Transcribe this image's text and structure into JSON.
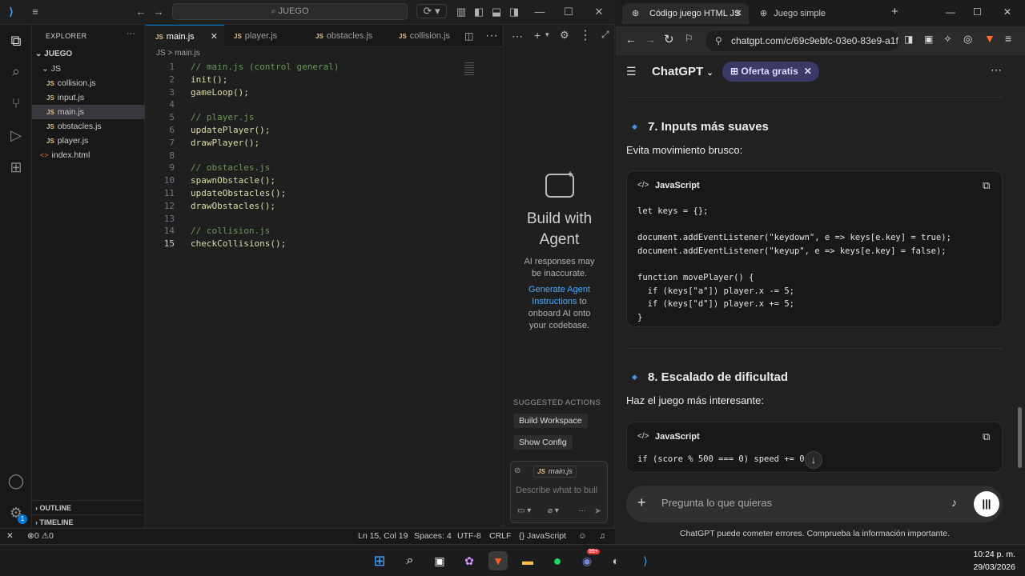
{
  "vscode": {
    "search": "JUEGO",
    "explorer_title": "EXPLORER",
    "tree": [
      {
        "label": "JUEGO",
        "type": "folder"
      },
      {
        "label": "JS",
        "type": "folder"
      },
      {
        "label": "collision.js",
        "type": "js"
      },
      {
        "label": "input.js",
        "type": "js"
      },
      {
        "label": "main.js",
        "type": "js",
        "selected": true
      },
      {
        "label": "obstacles.js",
        "type": "js"
      },
      {
        "label": "player.js",
        "type": "js"
      },
      {
        "label": "index.html",
        "type": "html"
      }
    ],
    "outline": "OUTLINE",
    "timeline": "TIMELINE",
    "tabs": [
      "main.js",
      "player.js",
      "obstacles.js",
      "collision.js"
    ],
    "breadcrumb": "JS  >  main.js",
    "lines": [
      {
        "n": "1",
        "t": "// main.js (control general)",
        "c": true
      },
      {
        "n": "2",
        "t": "init();"
      },
      {
        "n": "3",
        "t": "gameLoop();"
      },
      {
        "n": "4",
        "t": ""
      },
      {
        "n": "5",
        "t": "// player.js",
        "c": true
      },
      {
        "n": "6",
        "t": "updatePlayer();"
      },
      {
        "n": "7",
        "t": "drawPlayer();"
      },
      {
        "n": "8",
        "t": ""
      },
      {
        "n": "9",
        "t": "// obstacles.js",
        "c": true
      },
      {
        "n": "10",
        "t": "spawnObstacle();"
      },
      {
        "n": "11",
        "t": "updateObstacles();"
      },
      {
        "n": "12",
        "t": "drawObstacles();"
      },
      {
        "n": "13",
        "t": ""
      },
      {
        "n": "14",
        "t": "// collision.js",
        "c": true
      },
      {
        "n": "15",
        "t": "checkCollisions();"
      }
    ],
    "agent": {
      "title1": "Build with",
      "title2": "Agent",
      "note1": "AI responses may",
      "note2": "be inaccurate.",
      "link1": "Generate Agent",
      "link2": "Instructions",
      "rest1": " to",
      "rest2": "onboard AI onto",
      "rest3": "your codebase.",
      "suggested": "SUGGESTED ACTIONS",
      "btn1": "Build Workspace",
      "btn2": "Show Config",
      "ctx_file": "main.js",
      "placeholder": "Describe what to buil"
    },
    "status": {
      "errors": "0",
      "warnings": "0",
      "pos": "Ln 15, Col 19",
      "spaces": "Spaces: 4",
      "enc": "UTF-8",
      "eol": "CRLF",
      "lang": "JavaScript",
      "accounts_badge": "1"
    }
  },
  "browser": {
    "tab1": "Código juego HTML JS",
    "tab2": "Juego simple",
    "url": "chatgpt.com/c/69c9ebfc-03e0-83e9-a1f",
    "app": "ChatGPT",
    "offer": "Oferta gratis",
    "s7_title": "7. Inputs más suaves",
    "s7_desc": "Evita movimiento brusco:",
    "lang": "JavaScript",
    "code7": [
      "let keys = {};",
      "",
      "document.addEventListener(\"keydown\", e => keys[e.key] = true);",
      "document.addEventListener(\"keyup\", e => keys[e.key] = false);",
      "",
      "function movePlayer() {",
      "  if (keys[\"a\"]) player.x -= 5;",
      "  if (keys[\"d\"]) player.x += 5;",
      "}"
    ],
    "s8_title": "8. Escalado de dificultad",
    "s8_desc": "Haz el juego más interesante:",
    "code8": "if (score % 500 === 0) speed += 0",
    "compose_placeholder": "Pregunta lo que quieras",
    "disclaimer": "ChatGPT puede cometer errores. Comprueba la información importante."
  },
  "taskbar": {
    "time": "10:24 p. m.",
    "date": "29/03/2026",
    "discord_badge": "99+"
  },
  "colors": {
    "accent": "#0078d4",
    "chatgpt_blue": "#4a90e2",
    "offer_bg": "#3b3a66"
  }
}
